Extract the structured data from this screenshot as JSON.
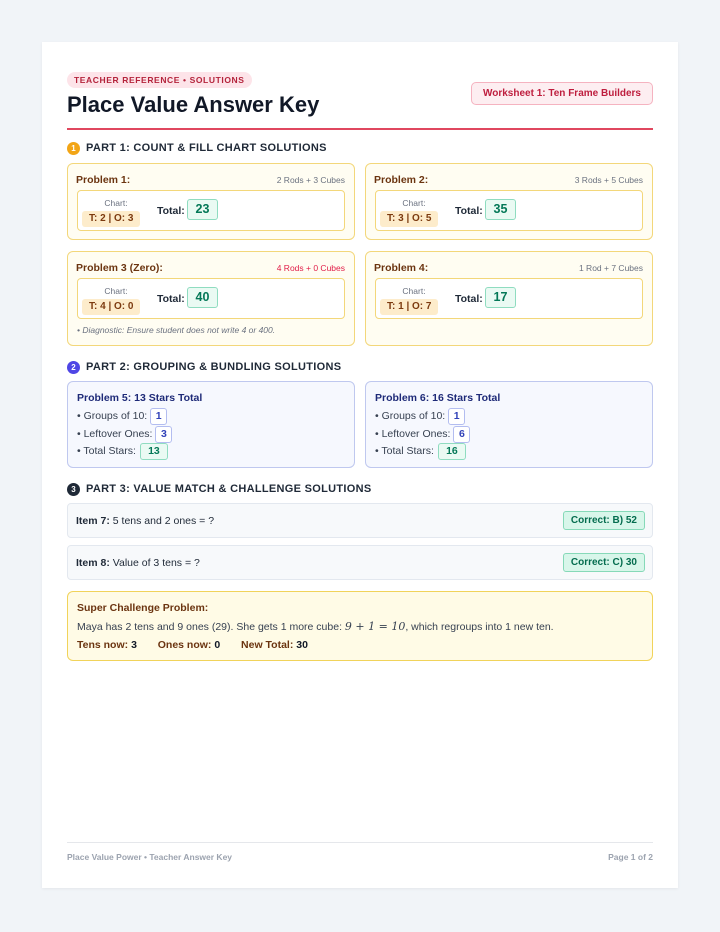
{
  "header": {
    "pill": "TEACHER REFERENCE • SOLUTIONS",
    "title": "Place Value Answer Key",
    "worksheet_badge": "Worksheet 1: Ten Frame Builders",
    "accent_color": "#e0475f"
  },
  "part1": {
    "number": "1",
    "label": "PART 1: COUNT & FILL CHART SOLUTIONS",
    "chart_label": "Chart:",
    "total_label": "Total:",
    "problems": [
      {
        "title": "Problem 1:",
        "note": "2 Rods + 3 Cubes",
        "chart": "T: 2 | O: 3",
        "total": "23"
      },
      {
        "title": "Problem 2:",
        "note": "3 Rods + 5 Cubes",
        "chart": "T: 3 | O: 5",
        "total": "35"
      },
      {
        "title": "Problem 3 (Zero):",
        "note": "4 Rods + 0 Cubes",
        "chart": "T: 4 | O: 0",
        "total": "40",
        "diagnostic": "• Diagnostic: Ensure student does not write 4 or 400."
      },
      {
        "title": "Problem 4:",
        "note": "1 Rod + 7 Cubes",
        "chart": "T: 1 | O: 7",
        "total": "17"
      }
    ]
  },
  "part2": {
    "number": "2",
    "label": "PART 2: GROUPING & BUNDLING SOLUTIONS",
    "problems": [
      {
        "title": "Problem 5: 13 Stars Total",
        "groups_label": "• Groups of 10:",
        "groups": "1",
        "leftover_label": "• Leftover Ones:",
        "leftover": "3",
        "total_label": "• Total Stars:",
        "total": "13"
      },
      {
        "title": "Problem 6: 16 Stars Total",
        "groups_label": "• Groups of 10:",
        "groups": "1",
        "leftover_label": "• Leftover Ones:",
        "leftover": "6",
        "total_label": "• Total Stars:",
        "total": "16"
      }
    ]
  },
  "part3": {
    "number": "3",
    "label": "PART 3: VALUE MATCH & CHALLENGE SOLUTIONS",
    "items": [
      {
        "label": "Item 7:",
        "question": "5 tens and 2 ones = ?",
        "answer": "Correct: B) 52"
      },
      {
        "label": "Item 8:",
        "question": "Value of 3 tens = ?",
        "answer": "Correct: C) 30"
      }
    ],
    "challenge": {
      "title": "Super Challenge Problem:",
      "text_before": "Maya has 2 tens and 9 ones (29). She gets 1 more cube: ",
      "math": "9 + 1 = 10",
      "text_after": ", which regroups into 1 new ten.",
      "tens_label": "Tens now:",
      "tens": "3",
      "ones_label": "Ones now:",
      "ones": "0",
      "total_label": "New Total:",
      "total": "30"
    }
  },
  "footer": {
    "left": "Place Value Power • Teacher Answer Key",
    "right": "Page 1 of 2"
  }
}
